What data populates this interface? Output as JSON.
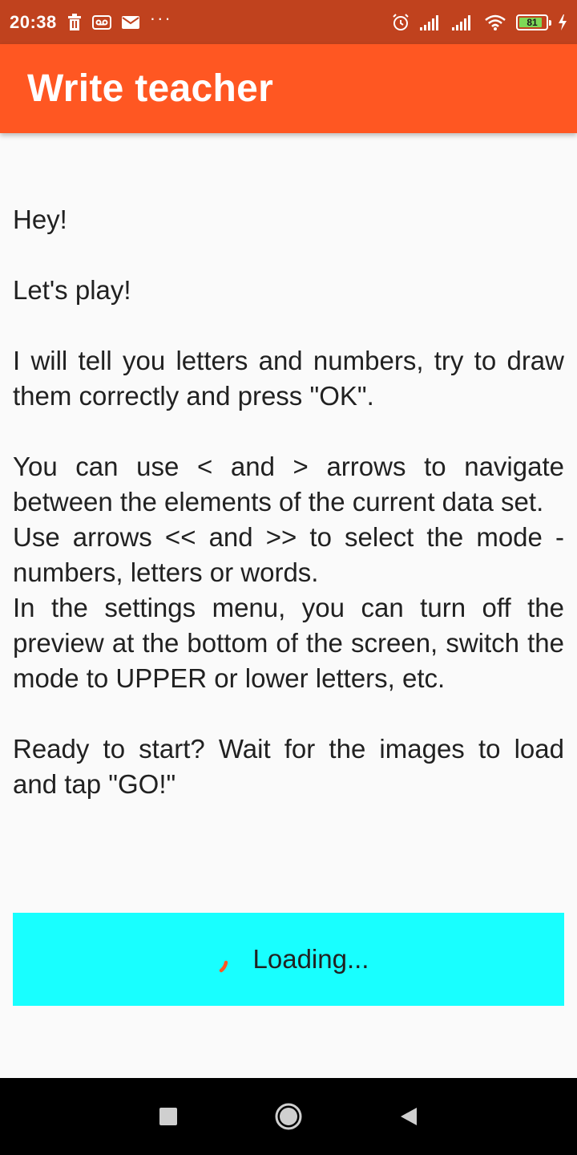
{
  "status_bar": {
    "time": "20:38",
    "battery": "81",
    "icons": [
      "trash-icon",
      "voicemail-icon",
      "mail-icon",
      "more-icon",
      "alarm-icon",
      "signal-icon",
      "signal-icon",
      "wifi-icon",
      "battery-icon",
      "charging-icon"
    ]
  },
  "app_bar": {
    "title": "Write teacher",
    "color": "#ff5722"
  },
  "intro": {
    "p1": "Hey!",
    "p2": "Let's play!",
    "p3": "I will tell you letters and numbers, try to draw them correctly and press \"OK\".",
    "p4": "You can use < and > arrows to navigate between the elements of the current data set.",
    "p5": "Use arrows << and >> to select the mode - numbers, letters or words.",
    "p6": "In the settings menu, you can turn off the preview at the bottom of the screen, switch the mode to UPPER or lower letters, etc.",
    "p7": "Ready to start? Wait for the images to load and tap \"GO!\""
  },
  "loading": {
    "label": "Loading...",
    "color": "#18ffff",
    "spinner_color": "#ff5722"
  },
  "nav_bar": {
    "icons": [
      "recent-apps-icon",
      "home-icon",
      "back-icon"
    ]
  }
}
